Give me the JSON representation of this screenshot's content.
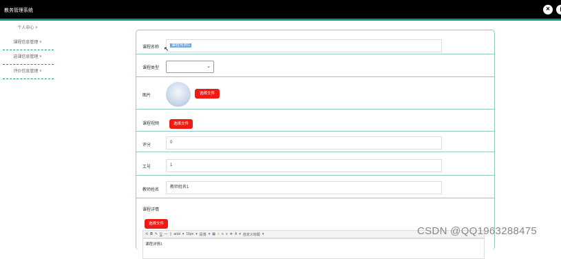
{
  "app": {
    "title": "教务管理系统"
  },
  "window_buttons": {
    "close_symbol": "×",
    "extra_symbol": "("
  },
  "sidebar": {
    "items": [
      {
        "label": "个人中心 ˅"
      },
      {
        "label": "课程信息管理 ˅"
      },
      {
        "label": "选课信息管理 ˅"
      },
      {
        "label": "评价信息管理 ˅"
      }
    ]
  },
  "form": {
    "course_name_label": "课程名称",
    "course_name_value": "课程名称1",
    "course_type_label": "课程类型",
    "course_type_value": "",
    "image_label": "图片",
    "image_button": "选择文件",
    "video_label": "课程视频",
    "video_button": "选择文件",
    "score_label": "评分",
    "score_value": "0",
    "staff_no_label": "工号",
    "staff_no_value": "1",
    "teacher_label": "教师姓名",
    "teacher_value": "教师姓名1",
    "detail_label": "课程详情",
    "detail_button": "选择文件",
    "editor": {
      "font": "arial",
      "size": "16px",
      "heading": "段落",
      "style": "自定义标题",
      "content": "课程详情1"
    }
  },
  "watermark": "CSDN @QQ1963288475",
  "icons": {
    "close": "close-icon",
    "dropdown": "chevron-down-icon",
    "cursor": "mouse-cursor-icon"
  }
}
